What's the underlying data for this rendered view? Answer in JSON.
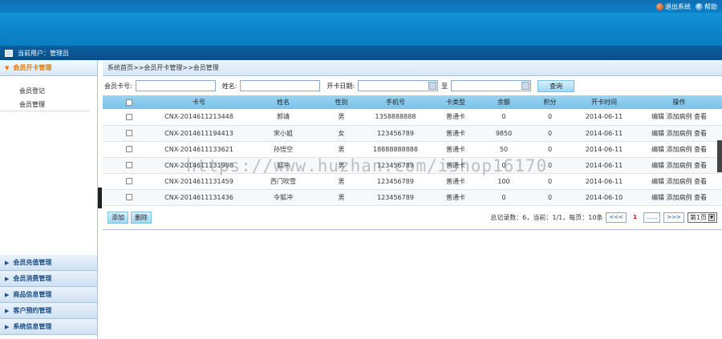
{
  "header": {
    "exit_label": "退出系统",
    "help_label": "帮助"
  },
  "userbar": {
    "text": "当前用户：管理员"
  },
  "sidebar": {
    "sections": [
      {
        "label": "会员开卡管理",
        "active": true
      },
      {
        "label": "会员充值管理"
      },
      {
        "label": "会员消费管理"
      },
      {
        "label": "商品信息管理"
      },
      {
        "label": "客户预约管理"
      },
      {
        "label": "系统信息管理"
      }
    ],
    "subitems": [
      {
        "label": "会员登记"
      },
      {
        "label": "会员管理"
      }
    ]
  },
  "breadcrumb": "系统首页>>会员开卡管理>>会员管理",
  "search": {
    "card_label": "会员卡号:",
    "card_value": "",
    "name_label": "姓名:",
    "name_value": "",
    "date_label": "开卡日期:",
    "to_label": "至",
    "query_label": "查询"
  },
  "table": {
    "headers": [
      "卡号",
      "姓名",
      "性别",
      "手机号",
      "卡类型",
      "余额",
      "积分",
      "开卡时间",
      "操作"
    ],
    "rows": [
      {
        "card": "CNX-2014611213448",
        "name": "郭靖",
        "gender": "男",
        "phone": "1358888888",
        "type": "普通卡",
        "balance": "0",
        "points": "0",
        "date": "2014-06-11"
      },
      {
        "card": "CNX-2014611194413",
        "name": "宋小姐",
        "gender": "女",
        "phone": "123456789",
        "type": "普通卡",
        "balance": "9850",
        "points": "0",
        "date": "2014-06-11"
      },
      {
        "card": "CNX-2014611133621",
        "name": "孙悟空",
        "gender": "男",
        "phone": "18888888888",
        "type": "普通卡",
        "balance": "50",
        "points": "0",
        "date": "2014-06-11"
      },
      {
        "card": "CNX-2014611131908",
        "name": "狐冲",
        "gender": "男",
        "phone": "123456789",
        "type": "普通卡",
        "balance": "0",
        "points": "0",
        "date": "2014-06-11"
      },
      {
        "card": "CNX-2014611131459",
        "name": "西门吹雪",
        "gender": "男",
        "phone": "123456789",
        "type": "普通卡",
        "balance": "100",
        "points": "0",
        "date": "2014-06-11"
      },
      {
        "card": "CNX-2014611131436",
        "name": "令狐冲",
        "gender": "男",
        "phone": "123456789",
        "type": "普通卡",
        "balance": "0",
        "points": "0",
        "date": "2014-06-10"
      }
    ],
    "ops": {
      "edit": "编辑",
      "add_case": "添加病例",
      "view": "查看"
    }
  },
  "actions": {
    "add_label": "添加",
    "delete_label": "删除"
  },
  "pagination": {
    "summary": "总记录数：6，当前：1/1，每页：10条",
    "first": "<<<",
    "current": "1",
    "ellipsis": "......",
    "last": ">>>",
    "page_select": "第1页"
  },
  "watermark": "https://www.huzhan.com/ishop16170",
  "colors": {
    "banner": "#0d86cc",
    "userbar": "#0a578f",
    "table_header": "#8ccdf0",
    "active_section": "#e07a00",
    "link": "#1a3f8f"
  }
}
